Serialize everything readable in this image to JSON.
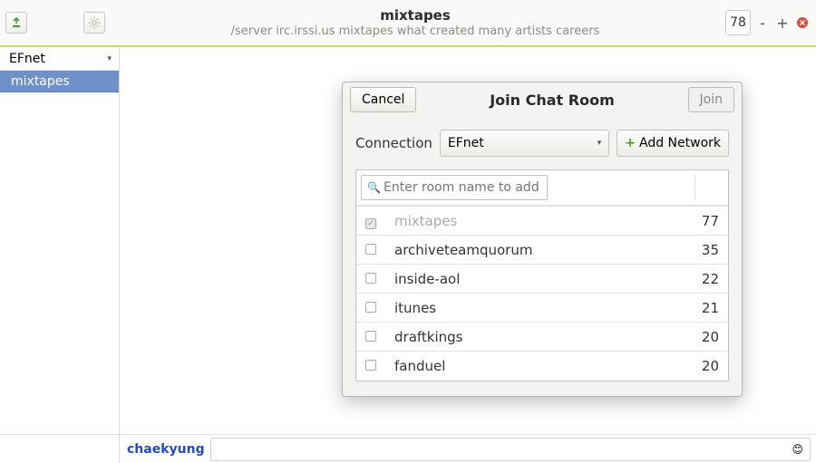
{
  "titlebar": {
    "title": "mixtapes",
    "subtitle": "/server irc.irssi.us mixtapes what created many artists careers",
    "user_count": "78"
  },
  "sidebar": {
    "network": "EFnet",
    "channel": "mixtapes"
  },
  "dialog": {
    "cancel": "Cancel",
    "title": "Join Chat Room",
    "join": "Join",
    "connection_label": "Connection",
    "connection_value": "EFnet",
    "add_network": "Add Network",
    "search_placeholder": "Enter room name to add",
    "rooms": [
      {
        "name": "mixtapes",
        "count": "77",
        "checked": true
      },
      {
        "name": "archiveteamquorum",
        "count": "35",
        "checked": false
      },
      {
        "name": "inside-aol",
        "count": "22",
        "checked": false
      },
      {
        "name": "itunes",
        "count": "21",
        "checked": false
      },
      {
        "name": "draftkings",
        "count": "20",
        "checked": false
      },
      {
        "name": "fanduel",
        "count": "20",
        "checked": false
      }
    ]
  },
  "bottom": {
    "nick": "chaekyung"
  }
}
